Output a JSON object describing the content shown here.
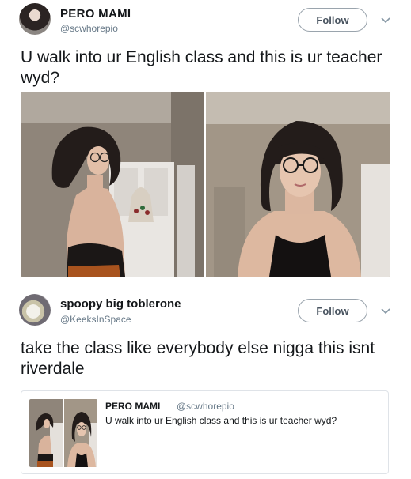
{
  "tweet": {
    "author_name": "PERO MAMI",
    "author_handle": "@scwhorepio",
    "follow_label": "Follow",
    "text": "U walk into ur English class and this is ur teacher wyd?",
    "media": [
      {
        "icon": "photo-woman-standing-side-view"
      },
      {
        "icon": "photo-woman-selfie-glasses"
      }
    ]
  },
  "reply": {
    "author_name": "spoopy big toblerone",
    "author_handle": "@KeeksInSpace",
    "follow_label": "Follow",
    "text": "take the class like everybody else nigga this isnt riverdale",
    "quoted": {
      "author_name": "PERO MAMI",
      "author_handle": "@scwhorepio",
      "text": "U walk into ur English class and this is ur teacher wyd?"
    }
  },
  "colors": {
    "text": "#14171a",
    "secondary": "#657786",
    "border": "#dfe3e8",
    "wall": "#9b8f82",
    "hair": "#231c1a",
    "skin": "#e2bfa8"
  }
}
